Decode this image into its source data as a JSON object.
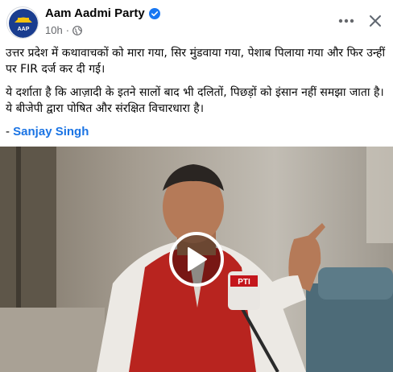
{
  "post": {
    "page_name": "Aam Aadmi Party",
    "time": "10h",
    "separator": "·",
    "avatar_text": "AAP",
    "paragraph1": "उत्तर प्रदेश में कथावाचकों को मारा गया, सिर मुंडवाया गया, पेशाब पिलाया गया और फिर उन्हीं पर FIR दर्ज कर दी गई।",
    "paragraph2": "ये दर्शाता है कि आज़ादी के इतने सालों बाद भी दलितों, पिछड़ों को इंसान नहीं समझा जाता है। ये बीजेपी द्वारा पोषित और संरक्षित  विचारधारा है।",
    "author_prefix": "- ",
    "author_name": "Sanjay Singh",
    "mic_label": "PTI"
  },
  "colors": {
    "link": "#1b74e4",
    "secondary_text": "#65676b",
    "verified": "#1877f2",
    "logo_yellow": "#f4c20d",
    "logo_blue": "#1a3d8f"
  },
  "icons": [
    "aap-logo",
    "verified-badge-icon",
    "globe-icon",
    "more-icon",
    "close-icon",
    "play-icon"
  ]
}
